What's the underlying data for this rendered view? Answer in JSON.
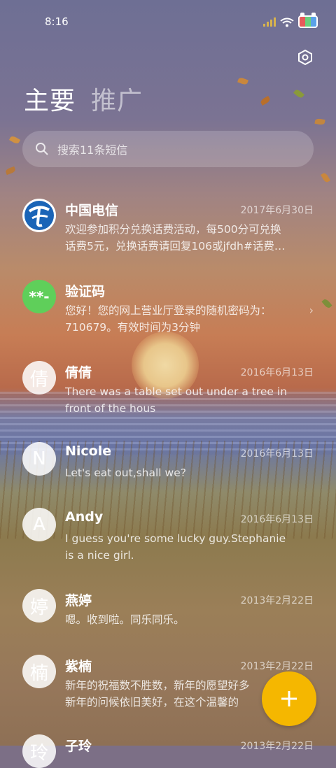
{
  "status": {
    "time": "8:16"
  },
  "tabs": [
    {
      "label": "主要",
      "active": true
    },
    {
      "label": "推广",
      "active": false
    }
  ],
  "search": {
    "placeholder": "搜索11条短信"
  },
  "accent_color": "#f5b700",
  "messages": [
    {
      "name": "中国电信",
      "date": "2017年6月30日",
      "preview": [
        "欢迎参加积分兑换话费活动，每500分可兑换",
        "话费5元，兑换话费请回复106或jfdh#话费…"
      ],
      "avatar": "telecom-logo"
    },
    {
      "name": "验证码",
      "date": "",
      "preview": [
        "您好！您的网上营业厅登录的随机密码为：",
        "710679。有效时间为3分钟"
      ],
      "avatar_text": "**-"
    },
    {
      "name": "倩倩",
      "date": "2016年6月13日",
      "preview": [
        "There was a table set out under a tree in",
        "front of the hous"
      ],
      "avatar_text": "倩"
    },
    {
      "name": "Nicole",
      "date": "2016年6月13日",
      "preview": [
        "Let's eat out,shall we?"
      ],
      "avatar_text": "N"
    },
    {
      "name": "Andy",
      "date": "2016年6月13日",
      "preview": [
        "I guess you're some lucky guy.Stephanie",
        "is a nice girl."
      ],
      "avatar_text": "A"
    },
    {
      "name": "燕婷",
      "date": "2013年2月22日",
      "preview": [
        "嗯。收到啦。同乐同乐。"
      ],
      "avatar_text": "婷"
    },
    {
      "name": "紫楠",
      "date": "2013年2月22日",
      "preview": [
        "新年的祝福数不胜数，新年的愿望好多",
        "新年的问候依旧美好，在这个温馨的"
      ],
      "avatar_text": "楠"
    },
    {
      "name": "子玲",
      "date": "2013年2月22日",
      "preview": [],
      "avatar_text": "玲"
    }
  ]
}
